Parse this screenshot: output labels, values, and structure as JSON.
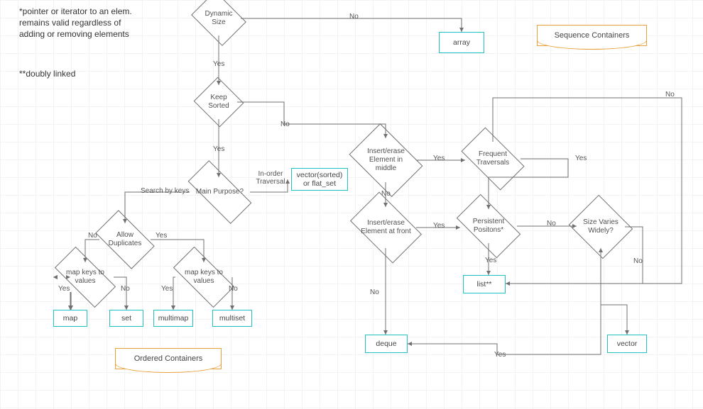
{
  "notes": {
    "footnote1": "*pointer or iterator to an elem. remains valid regardless of adding or removing elements",
    "footnote2": "**doubly linked"
  },
  "titles": {
    "sequence": "Sequence Containers",
    "ordered": "Ordered Containers"
  },
  "decisions": {
    "dynamic_size": "Dynamic Size",
    "keep_sorted": "Keep Sorted",
    "main_purpose": "Main Purpose?",
    "allow_duplicates": "Allow Duplicates",
    "map_keys_left": "map keys to values",
    "map_keys_right": "map keys to values",
    "insert_middle": "Insert/erase Element in middle",
    "insert_front": "Insert/erase Element at front",
    "frequent_traversals": "Frequent Traversals",
    "persistent_positions": "Persistent Positons*",
    "size_varies": "Size Varies Widely?"
  },
  "results": {
    "array": "array",
    "vector_sorted": "vector(sorted) or flat_set",
    "map": "map",
    "set": "set",
    "multimap": "multimap",
    "multiset": "multiset",
    "list": "list**",
    "deque": "deque",
    "vector": "vector"
  },
  "edges": {
    "yes": "Yes",
    "no": "No",
    "search_by_keys": "Search by keys",
    "in_order_traversal": "In-order Traversal"
  }
}
